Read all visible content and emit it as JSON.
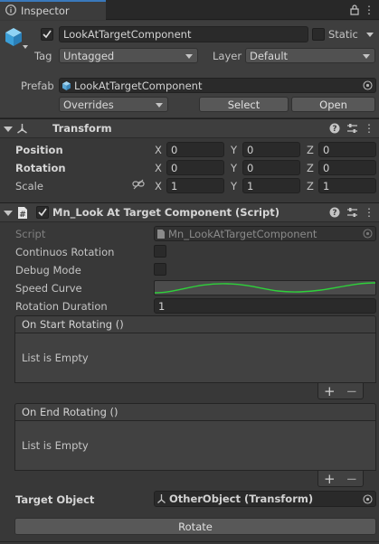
{
  "window": {
    "tab_title": "Inspector"
  },
  "gameobject": {
    "name": "LookAtTargetComponent",
    "static_label": "Static",
    "tag_label": "Tag",
    "tag_value": "Untagged",
    "layer_label": "Layer",
    "layer_value": "Default",
    "prefab_label": "Prefab",
    "prefab_value": "LookAtTargetComponent",
    "overrides_value": "Overrides",
    "select_label": "Select",
    "open_label": "Open"
  },
  "transform": {
    "title": "Transform",
    "rows": [
      {
        "label": "Position",
        "x": "0",
        "y": "0",
        "z": "0"
      },
      {
        "label": "Rotation",
        "x": "0",
        "y": "0",
        "z": "0"
      },
      {
        "label": "Scale",
        "x": "1",
        "y": "1",
        "z": "1"
      }
    ],
    "axis": {
      "x": "X",
      "y": "Y",
      "z": "Z"
    }
  },
  "script_component": {
    "title": "Mn_Look At Target Component (Script)",
    "script_label": "Script",
    "script_value": "Mn_LookAtTargetComponent",
    "continuos_label": "Continuos Rotation",
    "debug_label": "Debug Mode",
    "speed_label": "Speed Curve",
    "duration_label": "Rotation Duration",
    "duration_value": "1",
    "curve_color": "#2ed13a",
    "on_start": {
      "header": "On Start Rotating ()",
      "empty": "List is Empty"
    },
    "on_end": {
      "header": "On End Rotating ()",
      "empty": "List is Empty"
    },
    "target_label": "Target Object",
    "target_value": "OtherObject (Transform)",
    "rotate_label": "Rotate"
  },
  "glyphs": {
    "plus": "+",
    "minus": "−",
    "help": "?",
    "menu": "⋮",
    "settings": "⇄",
    "lock": "🔒"
  },
  "colors": {
    "accent": "#3a79bb",
    "background": "#383838"
  }
}
